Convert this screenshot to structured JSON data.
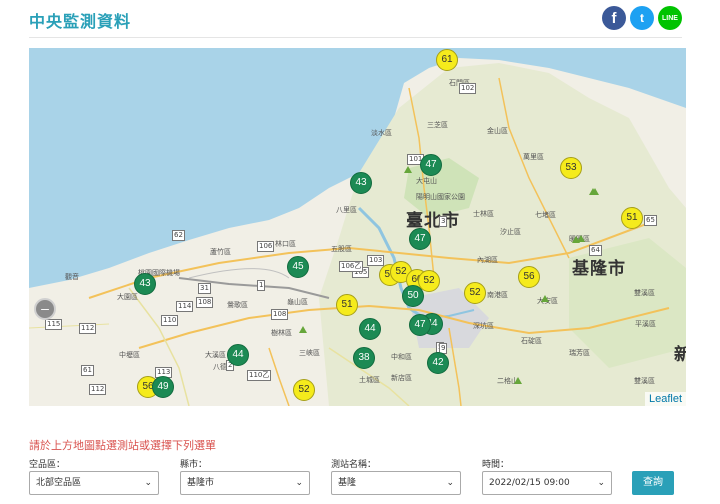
{
  "header": {
    "title": "中央監測資料"
  },
  "social": {
    "facebook": "f",
    "twitter": "t",
    "line": "LINE"
  },
  "map": {
    "zoom_label": "–",
    "attribution": "Leaflet",
    "cities": [
      "臺北市",
      "基隆市"
    ],
    "place_labels": [
      "石門區",
      "三芝區",
      "淡水區",
      "金山區",
      "萬里區",
      "大屯山",
      "陽明山國家公園",
      "八里區",
      "士林區",
      "七堵區",
      "暖暖區",
      "汐止區",
      "內湖區",
      "蘆竹區",
      "林口區",
      "五股區",
      "大園區",
      "中壢區",
      "八德區",
      "大溪區",
      "三峽區",
      "土城區",
      "中和區",
      "新店區",
      "南港區",
      "大安區",
      "平溪區",
      "瑞芳區",
      "深坑區",
      "石碇區",
      "雙溪區",
      "二格山",
      "雙溪區",
      "新",
      "桃園國際機場",
      "鶯歌區",
      "龜山區",
      "觀音",
      "樹林區"
    ],
    "road_shields": [
      "106",
      "101",
      "105",
      "102",
      "103",
      "108",
      "114",
      "110",
      "113",
      "115",
      "112",
      "112",
      "108",
      "1",
      "2",
      "3",
      "5",
      "9",
      "31",
      "61",
      "62",
      "64",
      "65",
      "106乙",
      "110乙"
    ],
    "markers": [
      {
        "value": "61",
        "color": "yellow"
      },
      {
        "value": "47",
        "color": "green"
      },
      {
        "value": "53",
        "color": "yellow"
      },
      {
        "value": "43",
        "color": "green"
      },
      {
        "value": "51",
        "color": "yellow"
      },
      {
        "value": "47",
        "color": "green"
      },
      {
        "value": "45",
        "color": "green"
      },
      {
        "value": "57",
        "color": "yellow"
      },
      {
        "value": "52",
        "color": "yellow"
      },
      {
        "value": "60",
        "color": "yellow"
      },
      {
        "value": "52",
        "color": "yellow"
      },
      {
        "value": "56",
        "color": "yellow"
      },
      {
        "value": "43",
        "color": "green"
      },
      {
        "value": "50",
        "color": "green"
      },
      {
        "value": "52",
        "color": "yellow"
      },
      {
        "value": "51",
        "color": "yellow"
      },
      {
        "value": "44",
        "color": "green"
      },
      {
        "value": "44",
        "color": "green"
      },
      {
        "value": "47",
        "color": "green"
      },
      {
        "value": "44",
        "color": "green"
      },
      {
        "value": "38",
        "color": "green"
      },
      {
        "value": "42",
        "color": "green"
      },
      {
        "value": "56",
        "color": "yellow"
      },
      {
        "value": "49",
        "color": "green"
      },
      {
        "value": "52",
        "color": "yellow"
      }
    ]
  },
  "form": {
    "prompt": "請於上方地圖點選測站或選擇下列選單",
    "air_region_label": "空品區：",
    "air_region_value": "北部空品區",
    "county_label": "縣市：",
    "county_value": "基隆市",
    "station_label": "測站名稱：",
    "station_value": "基隆",
    "time_label": "時間：",
    "time_value": "2022/02/15 09:00",
    "query_label": "查詢"
  },
  "colors": {
    "accent": "#2aa0b8",
    "marker_good": "#1c8a54",
    "marker_moderate": "#f5eb1c",
    "prompt": "#d9534f"
  }
}
